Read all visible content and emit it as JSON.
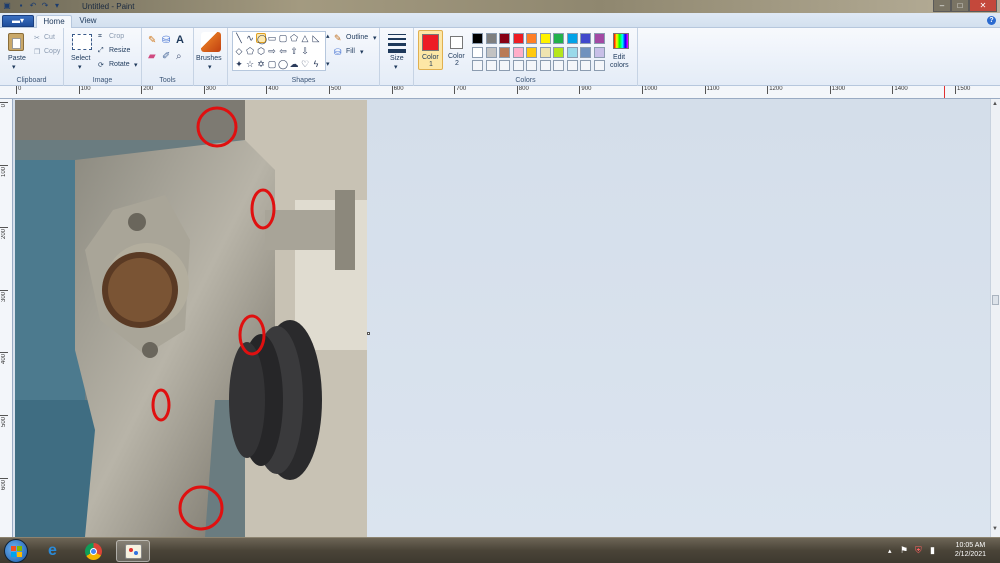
{
  "window": {
    "title": "Untitled - Paint",
    "controls": {
      "minimize": "–",
      "maximize": "□",
      "close": "✕"
    }
  },
  "menu": {
    "paint_button": "▬▾",
    "tabs": [
      {
        "label": "Home",
        "active": true
      },
      {
        "label": "View",
        "active": false
      }
    ],
    "help": "?"
  },
  "ribbon": {
    "clipboard": {
      "group_label": "Clipboard",
      "paste": "Paste",
      "cut": "Cut",
      "copy": "Copy"
    },
    "image": {
      "group_label": "Image",
      "select": "Select",
      "crop": "Crop",
      "resize": "Resize",
      "rotate": "Rotate"
    },
    "tools": {
      "group_label": "Tools"
    },
    "brushes": {
      "label": "Brushes"
    },
    "shapes": {
      "group_label": "Shapes",
      "outline": "Outline",
      "fill": "Fill"
    },
    "size": {
      "label": "Size"
    },
    "colors": {
      "group_label": "Colors",
      "color1_label": "Color",
      "color1_num": "1",
      "color2_label": "Color",
      "color2_num": "2",
      "edit_label": "Edit",
      "edit_label2": "colors",
      "color1": "#ed1c24",
      "color2": "#ffffff",
      "palette_row1": [
        "#000000",
        "#7f7f7f",
        "#880015",
        "#ed1c24",
        "#ff7f27",
        "#fff200",
        "#22b14c",
        "#00a2e8",
        "#3f48cc",
        "#a349a4"
      ],
      "palette_row2": [
        "#ffffff",
        "#c3c3c3",
        "#b97a57",
        "#ffaec9",
        "#ffc90e",
        "#efe4b0",
        "#b5e61d",
        "#99d9ea",
        "#7092be",
        "#c8bfe7"
      ]
    }
  },
  "ruler": {
    "h_labels": [
      "0",
      "100",
      "200",
      "300",
      "400",
      "500",
      "600",
      "700",
      "800",
      "900",
      "1000",
      "1100",
      "1200",
      "1300",
      "1400",
      "1500"
    ],
    "v_labels": [
      "0",
      "100",
      "200",
      "300",
      "400",
      "500",
      "600"
    ]
  },
  "taskbar": {
    "time": "10:05 AM",
    "date": "2/12/2021"
  }
}
